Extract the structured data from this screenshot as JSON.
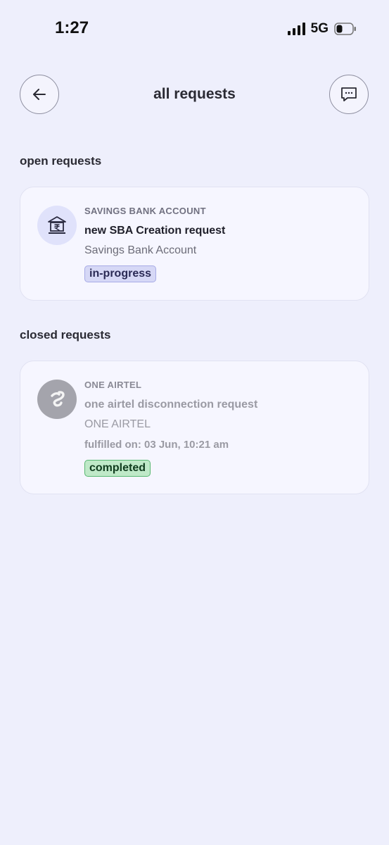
{
  "status_bar": {
    "time": "1:27",
    "network": "5G",
    "icons": [
      "signal-icon",
      "battery-icon"
    ]
  },
  "header": {
    "title": "all requests",
    "back_icon": "arrow-left-icon",
    "chat_icon": "chat-bubble-icon"
  },
  "open_section": {
    "title": "open requests",
    "items": [
      {
        "icon": "bank-icon",
        "category": "SAVINGS BANK ACCOUNT",
        "title": "new SBA Creation request",
        "subtitle": "Savings Bank Account",
        "status": "in-progress"
      }
    ]
  },
  "closed_section": {
    "title": "closed requests",
    "items": [
      {
        "icon": "airtel-logo-icon",
        "category": "ONE AIRTEL",
        "title": "one airtel disconnection request",
        "subtitle": "ONE AIRTEL",
        "fulfilled": "fulfilled on: 03 Jun, 10:21 am",
        "status": "completed"
      }
    ]
  },
  "colors": {
    "background": "#eeeffc",
    "card": "#f6f6ff",
    "progress_badge": "#d6d8f6",
    "completed_badge": "#bfe9c8"
  }
}
